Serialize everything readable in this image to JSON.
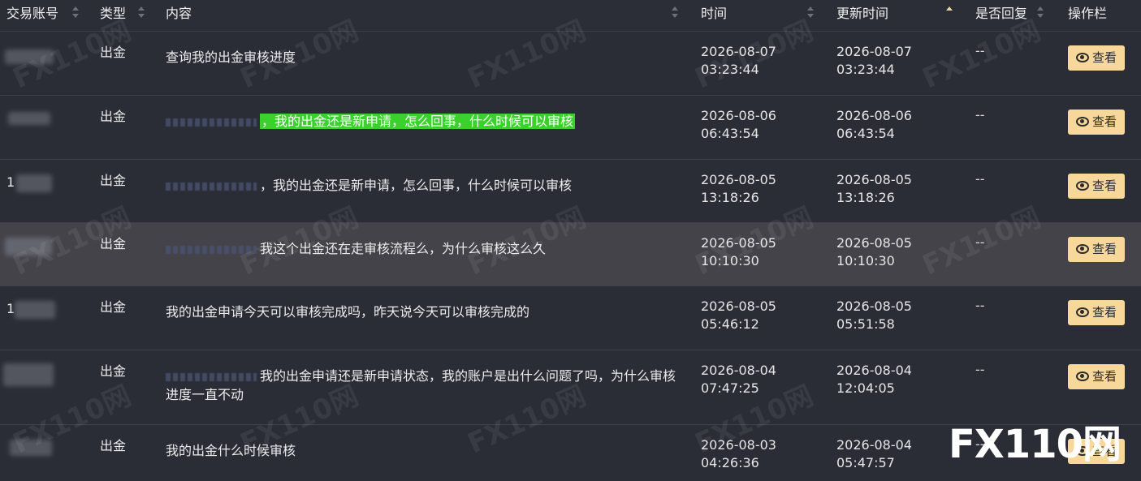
{
  "header": {
    "col_account": "交易账号",
    "col_type": "类型",
    "col_content": "内容",
    "col_time": "时间",
    "col_updated": "更新时间",
    "col_replied": "是否回复",
    "col_actions": "操作栏"
  },
  "rows": [
    {
      "type": "出金",
      "content": "查询我的出金审核进度",
      "time_date": "2026-08-07",
      "time_clock": "03:23:44",
      "upd_date": "2026-08-07",
      "upd_clock": "03:23:44",
      "replied": "--",
      "action": "查看"
    },
    {
      "type": "出金",
      "content": "，我的出金还是新申请，怎么回事，什么时候可以审核",
      "time_date": "2026-08-06",
      "time_clock": "06:43:54",
      "upd_date": "2026-08-06",
      "upd_clock": "06:43:54",
      "replied": "--",
      "action": "查看"
    },
    {
      "type": "出金",
      "content": "，我的出金还是新申请，怎么回事，什么时候可以审核",
      "time_date": "2026-08-05",
      "time_clock": "13:18:26",
      "upd_date": "2026-08-05",
      "upd_clock": "13:18:26",
      "replied": "--",
      "action": "查看"
    },
    {
      "type": "出金",
      "content": "我这个出金还在走审核流程么，为什么审核这么久",
      "time_date": "2026-08-05",
      "time_clock": "10:10:30",
      "upd_date": "2026-08-05",
      "upd_clock": "10:10:30",
      "replied": "--",
      "action": "查看"
    },
    {
      "type": "出金",
      "content": "我的出金申请今天可以审核完成吗，昨天说今天可以审核完成的",
      "time_date": "2026-08-05",
      "time_clock": "05:46:12",
      "upd_date": "2026-08-05",
      "upd_clock": "05:51:58",
      "replied": "--",
      "action": "查看"
    },
    {
      "type": "出金",
      "content": "我的出金申请还是新申请状态，我的账户是出什么问题了吗，为什么审核进度一直不动",
      "time_date": "2026-08-04",
      "time_clock": "07:47:25",
      "upd_date": "2026-08-04",
      "upd_clock": "12:04:05",
      "replied": "--",
      "action": "查看"
    },
    {
      "type": "出金",
      "content": "我的出金什么时候审核",
      "time_date": "2026-08-03",
      "time_clock": "04:26:36",
      "upd_date": "2026-08-04",
      "upd_clock": "05:47:57",
      "replied": "--",
      "action": "查看"
    }
  ],
  "account_digits": {
    "row3": "1",
    "row5": "1"
  },
  "watermark": "FX110网",
  "logo": "FX110网",
  "colors": {
    "accent_button": "#f7d79a",
    "highlight_green": "#3bd12c",
    "background": "#2a2d36",
    "hover_row": "#44434a"
  }
}
